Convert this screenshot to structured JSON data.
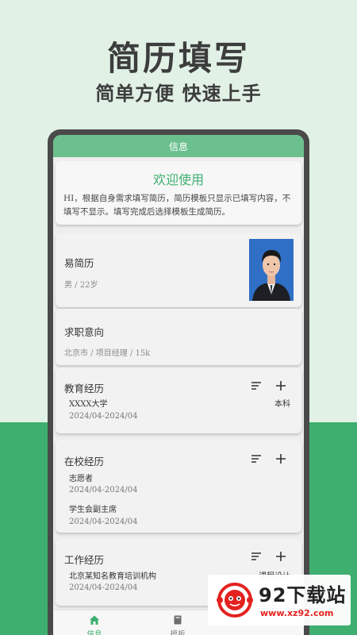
{
  "hero": {
    "title": "简历填写",
    "subtitle": "简单方便 快速上手"
  },
  "app": {
    "bar_title": "信息",
    "welcome": {
      "title": "欢迎使用",
      "text": "HI，根据自身需求填写简历，简历模板只显示已填写内容，不填写不显示。填写完成后选择模板生成简历。"
    },
    "profile": {
      "name": "易简历",
      "details": "男 / 22岁"
    },
    "intention": {
      "title": "求职意向",
      "details": "北京市 / 项目经理 / 15k"
    },
    "education": {
      "title": "教育经历",
      "items": [
        {
          "name": "XXXX大学",
          "date": "2024/04-2024/04",
          "right": "本科"
        }
      ]
    },
    "campus": {
      "title": "在校经历",
      "items": [
        {
          "name": "志愿者",
          "date": "2024/04-2024/04"
        },
        {
          "name": "学生会副主席",
          "date": "2024/04-2024/04"
        }
      ]
    },
    "work": {
      "title": "工作经历",
      "items": [
        {
          "name": "北京某知名教育培训机构",
          "date": "2024/04-2024/04",
          "right": "课程设计"
        }
      ]
    },
    "tabs": [
      {
        "label": "信息",
        "icon": "home-icon",
        "active": true
      },
      {
        "label": "模板",
        "icon": "book-icon",
        "active": false
      }
    ]
  },
  "watermark": {
    "brand": "92下载站",
    "url": "www.xz92.com"
  },
  "colors": {
    "accent": "#3eaf6e",
    "bar": "#6cc08e",
    "background": "#e1f1e5"
  }
}
